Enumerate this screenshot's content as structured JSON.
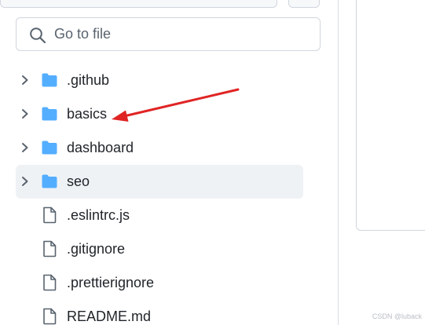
{
  "search": {
    "placeholder": "Go to file",
    "value": ""
  },
  "tree": {
    "items": [
      {
        "label": ".github",
        "type": "folder",
        "icon": "folder-icon"
      },
      {
        "label": "basics",
        "type": "folder",
        "icon": "folder-icon"
      },
      {
        "label": "dashboard",
        "type": "folder",
        "icon": "folder-icon"
      },
      {
        "label": "seo",
        "type": "folder",
        "icon": "folder-icon",
        "selected": true
      },
      {
        "label": ".eslintrc.js",
        "type": "file",
        "icon": "file-icon"
      },
      {
        "label": ".gitignore",
        "type": "file",
        "icon": "file-icon"
      },
      {
        "label": ".prettierignore",
        "type": "file",
        "icon": "file-icon"
      },
      {
        "label": "README.md",
        "type": "file",
        "icon": "file-icon"
      }
    ]
  },
  "annotation": {
    "color": "#e02424",
    "icon": "arrow-icon"
  },
  "watermark": "CSDN @luback",
  "colors": {
    "folder": "#54aeff",
    "selected_row": "#eff2f5",
    "border": "#d0d7de"
  }
}
